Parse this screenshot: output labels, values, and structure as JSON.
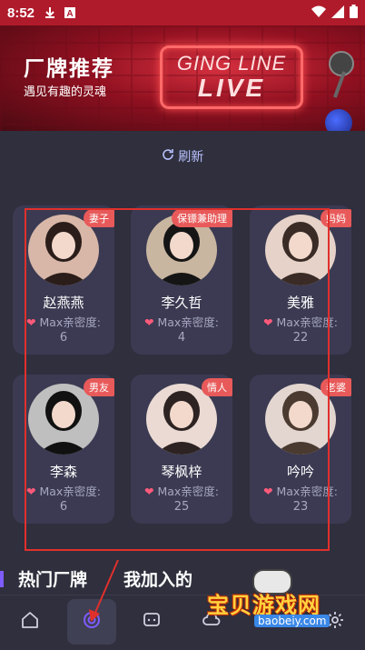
{
  "status_bar": {
    "time": "8:52",
    "icons_left": [
      "download-icon",
      "app-a-icon"
    ],
    "icons_right": [
      "wifi-icon",
      "signal-icon",
      "battery-icon"
    ]
  },
  "banner": {
    "title": "厂牌推荐",
    "subtitle": "遇见有趣的灵魂",
    "neon_line1": "GING LINE",
    "neon_line2": "LIVE"
  },
  "refresh": {
    "label": "刷新",
    "icon": "refresh-icon"
  },
  "cards": [
    {
      "name": "赵燕燕",
      "badge": "妻子",
      "intimacy_label": "Max亲密度:",
      "intimacy_value": "6",
      "avatar_color": "#d8b7a8",
      "hair_color": "#2a1d1a"
    },
    {
      "name": "李久哲",
      "badge": "保镖兼助理",
      "intimacy_label": "Max亲密度:",
      "intimacy_value": "4",
      "avatar_color": "#c9b6a0",
      "hair_color": "#151515"
    },
    {
      "name": "美雅",
      "badge": "妈妈",
      "intimacy_label": "Max亲密度:",
      "intimacy_value": "22",
      "avatar_color": "#e6d2c8",
      "hair_color": "#3a2b26"
    },
    {
      "name": "李森",
      "badge": "男友",
      "intimacy_label": "Max亲密度:",
      "intimacy_value": "6",
      "avatar_color": "#bfbfbf",
      "hair_color": "#111111"
    },
    {
      "name": "琴枫梓",
      "badge": "情人",
      "intimacy_label": "Max亲密度:",
      "intimacy_value": "25",
      "avatar_color": "#eadad3",
      "hair_color": "#2d2322"
    },
    {
      "name": "吟吟",
      "badge": "老婆",
      "intimacy_label": "Max亲密度:",
      "intimacy_value": "23",
      "avatar_color": "#e3d6d0",
      "hair_color": "#4a3a30"
    }
  ],
  "tabs": [
    {
      "label": "热门厂牌",
      "active": true
    },
    {
      "label": "我加入的",
      "active": false
    }
  ],
  "bottom_nav": [
    {
      "icon": "home-icon",
      "active": false
    },
    {
      "icon": "discover-icon",
      "active": true
    },
    {
      "icon": "chat-icon",
      "active": false
    },
    {
      "icon": "cloud-icon",
      "active": false
    },
    {
      "icon": "settings-icon",
      "active": false
    }
  ],
  "watermark": {
    "text": "宝贝游戏网",
    "url": "baobeiy.com"
  },
  "colors": {
    "accent_red": "#e0302c",
    "badge": "#e85a5a",
    "card_bg": "#3b3a52",
    "page_bg": "#2f2f3d",
    "tab_indicator": "#7f5cff"
  }
}
